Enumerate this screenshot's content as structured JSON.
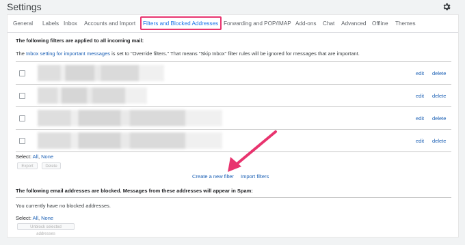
{
  "header": {
    "title": "Settings",
    "settings_icon": "gear-icon"
  },
  "tabs": [
    {
      "label": "General"
    },
    {
      "label": "Labels"
    },
    {
      "label": "Inbox"
    },
    {
      "label": "Accounts and Import"
    },
    {
      "label": "Filters and Blocked Addresses",
      "active": true
    },
    {
      "label": "Forwarding and POP/IMAP"
    },
    {
      "label": "Add-ons"
    },
    {
      "label": "Chat"
    },
    {
      "label": "Advanced"
    },
    {
      "label": "Offline"
    },
    {
      "label": "Themes"
    }
  ],
  "filters": {
    "heading": "The following filters are applied to all incoming mail:",
    "note_link": "Inbox setting for important messages",
    "note_prefix": "The",
    "note_suffix": "is set to \"Override filters.\" That means \"Skip Inbox\" filter rules will be ignored for messages that are important.",
    "rows": [
      {
        "edit": "edit",
        "delete": "delete"
      },
      {
        "edit": "edit",
        "delete": "delete"
      },
      {
        "edit": "edit",
        "delete": "delete"
      },
      {
        "edit": "edit",
        "delete": "delete"
      }
    ],
    "select_label": "Select:",
    "select_all": "All",
    "select_none": "None",
    "export_label": "Export",
    "delete_label": "Delete",
    "create_filter": "Create a new filter",
    "import_filters": "Import filters"
  },
  "blocked": {
    "heading": "The following email addresses are blocked. Messages from these addresses will appear in Spam:",
    "empty_text": "You currently have no blocked addresses.",
    "select_label": "Select:",
    "select_all": "All",
    "select_none": "None",
    "unblock_label": "Unblock selected addresses"
  },
  "colors": {
    "highlight": "#e8336e",
    "link": "#1a5fb4",
    "active_tab": "#1a73e8"
  }
}
